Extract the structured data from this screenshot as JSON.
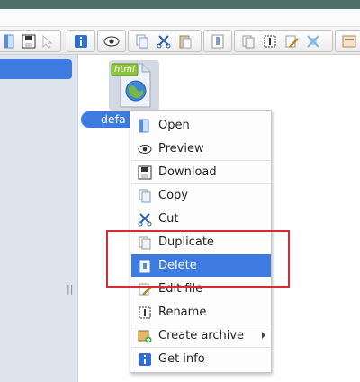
{
  "file": {
    "name": "default.html",
    "visible_name": "defa",
    "type_badge": "html"
  },
  "toolbar": {
    "icons": [
      "open-icon",
      "save-icon",
      "select-icon",
      "info-icon",
      "preview-icon",
      "copy-icon",
      "cut-icon",
      "paste-icon",
      "archive-icon",
      "duplicate-icon",
      "rename-icon",
      "edit-icon",
      "resize-icon",
      "view-icon"
    ]
  },
  "context_menu": {
    "items": [
      {
        "label": "Open",
        "icon": "open-icon"
      },
      {
        "label": "Preview",
        "icon": "eye-icon"
      },
      {
        "label": "Download",
        "icon": "floppy-icon"
      },
      {
        "label": "Copy",
        "icon": "copy-icon"
      },
      {
        "label": "Cut",
        "icon": "scissors-icon"
      },
      {
        "label": "Duplicate",
        "icon": "duplicate-icon"
      },
      {
        "label": "Delete",
        "icon": "trash-icon",
        "active": true
      },
      {
        "label": "Edit file",
        "icon": "pencil-icon"
      },
      {
        "label": "Rename",
        "icon": "rename-icon"
      },
      {
        "label": "Create archive",
        "icon": "archive-icon",
        "submenu": true
      },
      {
        "label": "Get info",
        "icon": "info-icon"
      }
    ]
  },
  "colors": {
    "selection": "#3d7be0",
    "highlight_border": "#d42b34",
    "header": "#4f6f69"
  }
}
